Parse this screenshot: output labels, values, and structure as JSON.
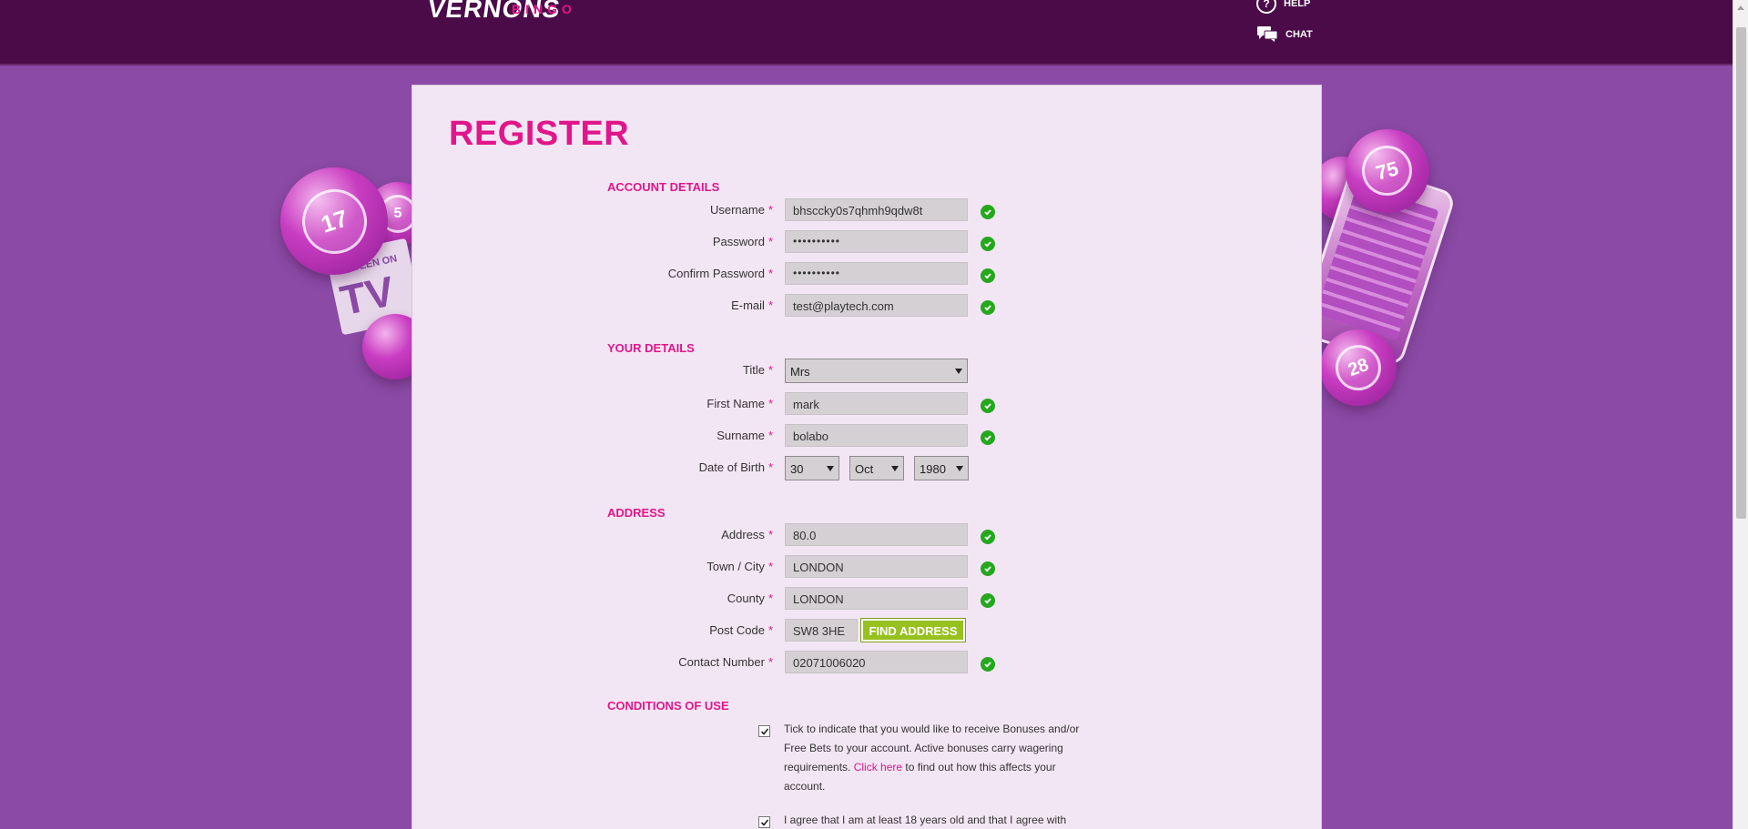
{
  "header": {
    "logo_brand": "VERNONS",
    "logo_sub": "BINGO",
    "help_label": "HELP",
    "chat_label": "CHAT"
  },
  "decor": {
    "balls": [
      "17",
      "5",
      "75",
      "28"
    ],
    "tv_small": "AS SEEN ON",
    "tv_big": "TV"
  },
  "page": {
    "title": "REGISTER"
  },
  "sections": {
    "account": "ACCOUNT DETAILS",
    "your_details": "YOUR DETAILS",
    "address": "ADDRESS",
    "conditions": "CONDITIONS OF USE"
  },
  "account": {
    "username": {
      "label": "Username",
      "value": "bhsccky0s7qhmh9qdw8t"
    },
    "password": {
      "label": "Password",
      "value": "••••••••••"
    },
    "confirm_password": {
      "label": "Confirm Password",
      "value": "••••••••••"
    },
    "email": {
      "label": "E-mail",
      "value": "test@playtech.com"
    }
  },
  "details": {
    "title": {
      "label": "Title",
      "value": "Mrs"
    },
    "first_name": {
      "label": "First Name",
      "value": "mark"
    },
    "surname": {
      "label": "Surname",
      "value": "bolabo"
    },
    "dob": {
      "label": "Date of Birth",
      "day": "30",
      "month": "Oct",
      "year": "1980"
    }
  },
  "address": {
    "address": {
      "label": "Address",
      "value": "80.0"
    },
    "town": {
      "label": "Town / City",
      "value": "LONDON"
    },
    "county": {
      "label": "County",
      "value": "LONDON"
    },
    "postcode": {
      "label": "Post Code",
      "value": "SW8 3HE"
    },
    "find_button": "FIND ADDRESS",
    "contact": {
      "label": "Contact Number",
      "value": "02071006020"
    }
  },
  "conditions": {
    "bonus_text_1": "Tick to indicate that you would like to receive Bonuses and/or Free Bets to your account. Active bonuses carry wagering requirements. ",
    "bonus_link": "Click here",
    "bonus_text_2": " to find out how this affects your account.",
    "age_text": "I agree that I am at least 18 years old and that I agree with"
  },
  "required_marker": "*",
  "colors": {
    "brand_pink": "#e0168a",
    "header_bg": "#4a0b48",
    "page_bg": "#8a4aa5",
    "panel_bg": "#f3e6f4",
    "valid_green": "#25a81e",
    "button_green": "#97c11e"
  }
}
